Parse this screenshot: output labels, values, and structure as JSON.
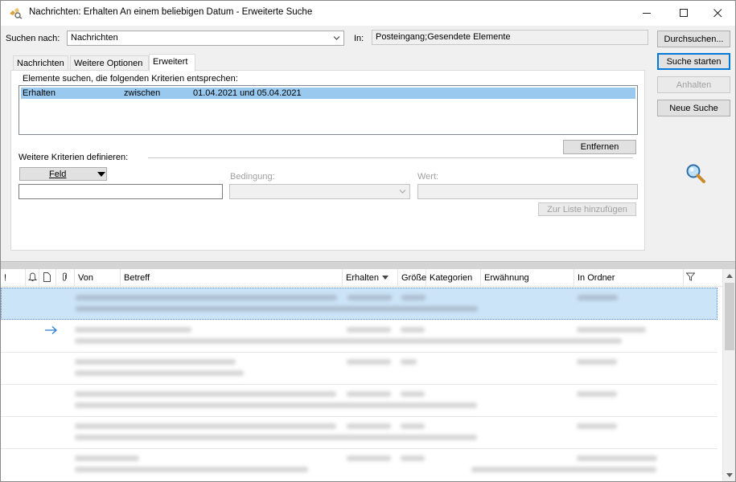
{
  "window": {
    "title": "Nachrichten: Erhalten An einem beliebigen Datum - Erweiterte Suche",
    "minimize_symbol": "—",
    "maximize_symbol": "☐",
    "close_symbol": "✕"
  },
  "search": {
    "label_search_for": "Suchen nach:",
    "search_for_value": "Nachrichten",
    "label_in": "In:",
    "in_value": "Posteingang;Gesendete Elemente"
  },
  "buttons": {
    "browse": "Durchsuchen...",
    "start": "Suche starten",
    "stop": "Anhalten",
    "new_search": "Neue Suche",
    "remove": "Entfernen",
    "add_to_list": "Zur Liste hinzufügen"
  },
  "tabs": [
    {
      "label": "Nachrichten"
    },
    {
      "label": "Weitere Optionen"
    },
    {
      "label": "Erweitert"
    }
  ],
  "advanced": {
    "criteria_heading": "Elemente suchen, die folgenden Kriterien entsprechen:",
    "criteria": [
      {
        "field": "Erhalten",
        "condition": "zwischen",
        "value": "01.04.2021 und 05.04.2021"
      }
    ],
    "more_criteria_heading": "Weitere Kriterien definieren:",
    "field_button": "Feld",
    "condition_label": "Bedingung:",
    "value_label": "Wert:"
  },
  "results": {
    "columns": [
      {
        "key": "importance",
        "label": "!"
      },
      {
        "key": "reminder",
        "label": ""
      },
      {
        "key": "icon",
        "label": ""
      },
      {
        "key": "attachment",
        "label": ""
      },
      {
        "key": "from",
        "label": "Von"
      },
      {
        "key": "subject",
        "label": "Betreff"
      },
      {
        "key": "received",
        "label": "Erhalten"
      },
      {
        "key": "size",
        "label": "Größe"
      },
      {
        "key": "categories",
        "label": "Kategorien"
      },
      {
        "key": "mention",
        "label": "Erwähnung"
      },
      {
        "key": "folder",
        "label": "In Ordner"
      }
    ],
    "row_count": 6
  },
  "colors": {
    "selection": "#cce4f7",
    "criteria_highlight": "#99c9ef",
    "accent": "#0078d7"
  }
}
